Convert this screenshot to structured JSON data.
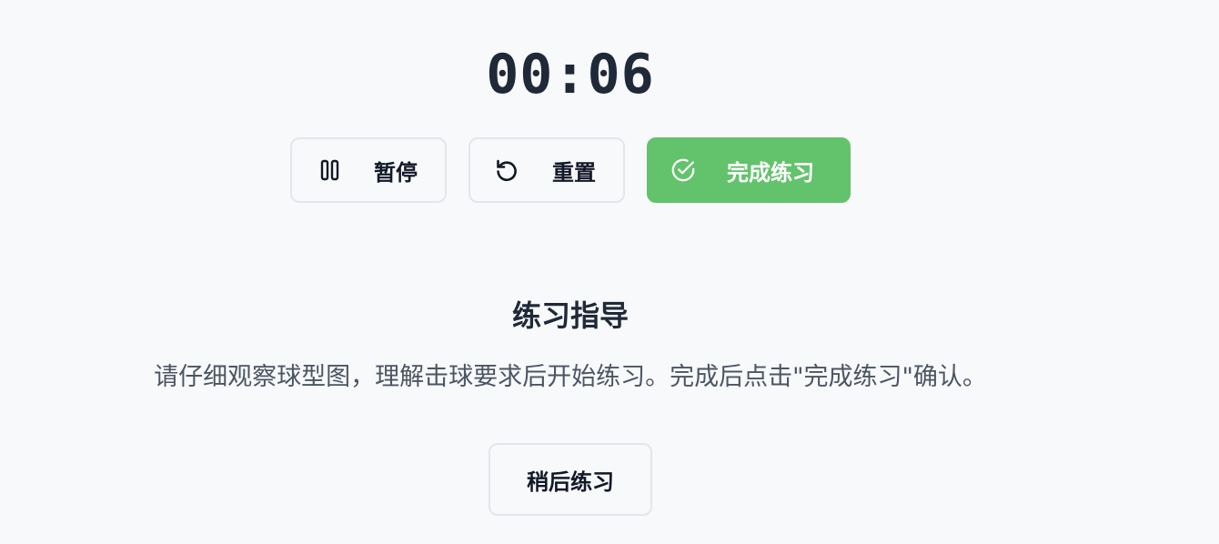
{
  "timer": {
    "display": "00:06"
  },
  "controls": {
    "pause": {
      "label": "暂停",
      "icon": "pause-icon"
    },
    "reset": {
      "label": "重置",
      "icon": "reset-icon"
    },
    "complete": {
      "label": "完成练习",
      "icon": "check-circle-icon"
    }
  },
  "guide": {
    "title": "练习指导",
    "text": "请仔细观察球型图，理解击球要求后开始练习。完成后点击\"完成练习\"确认。"
  },
  "later": {
    "label": "稍后练习"
  },
  "colors": {
    "accent_green": "#63c36c",
    "background": "#f8f9fb",
    "text_dark": "#1f2937",
    "text_muted": "#4b5563"
  }
}
